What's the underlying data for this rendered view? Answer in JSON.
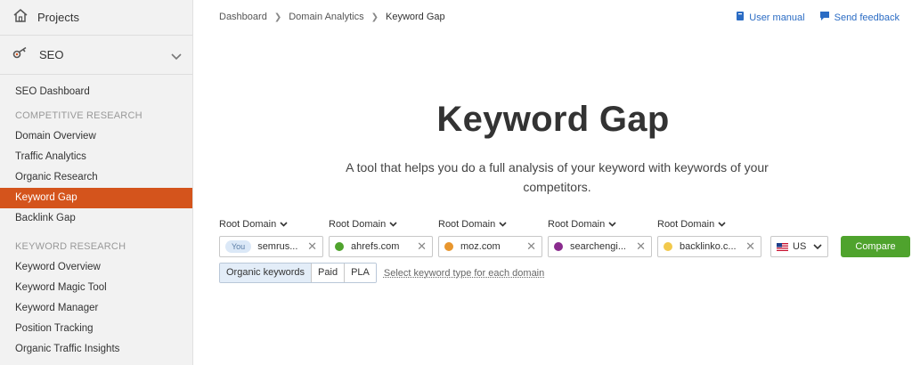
{
  "sidebar": {
    "projects_label": "Projects",
    "seo_label": "SEO",
    "items": [
      {
        "type": "item",
        "label": "SEO Dashboard"
      },
      {
        "type": "section",
        "label": "COMPETITIVE RESEARCH"
      },
      {
        "type": "item",
        "label": "Domain Overview"
      },
      {
        "type": "item",
        "label": "Traffic Analytics"
      },
      {
        "type": "item",
        "label": "Organic Research"
      },
      {
        "type": "item",
        "label": "Keyword Gap",
        "active": true
      },
      {
        "type": "item",
        "label": "Backlink Gap"
      },
      {
        "type": "section",
        "label": "KEYWORD RESEARCH"
      },
      {
        "type": "item",
        "label": "Keyword Overview"
      },
      {
        "type": "item",
        "label": "Keyword Magic Tool"
      },
      {
        "type": "item",
        "label": "Keyword Manager"
      },
      {
        "type": "item",
        "label": "Position Tracking"
      },
      {
        "type": "item",
        "label": "Organic Traffic Insights"
      }
    ]
  },
  "breadcrumb": [
    "Dashboard",
    "Domain Analytics",
    "Keyword Gap"
  ],
  "header_links": {
    "manual": "User manual",
    "feedback": "Send feedback"
  },
  "page": {
    "title": "Keyword Gap",
    "subtitle": "A tool that helps you do a full analysis of your keyword with keywords of your competitors."
  },
  "domains": [
    {
      "label": "Root Domain",
      "value": "semrus...",
      "badge": "You",
      "color": ""
    },
    {
      "label": "Root Domain",
      "value": "ahrefs.com",
      "color": "#4fa32d"
    },
    {
      "label": "Root Domain",
      "value": "moz.com",
      "color": "#e8962e"
    },
    {
      "label": "Root Domain",
      "value": "searchengi...",
      "color": "#8a2b8e"
    },
    {
      "label": "Root Domain",
      "value": "backlinko.c...",
      "color": "#f2c94c"
    }
  ],
  "country": "US",
  "compare_label": "Compare",
  "keyword_types": {
    "options": [
      "Organic keywords",
      "Paid",
      "PLA"
    ],
    "selected": "Organic keywords",
    "hint": "Select keyword type for each domain"
  },
  "colors": {
    "accent": "#d4541c",
    "compare": "#4fa32d",
    "link": "#2b6cc4"
  }
}
